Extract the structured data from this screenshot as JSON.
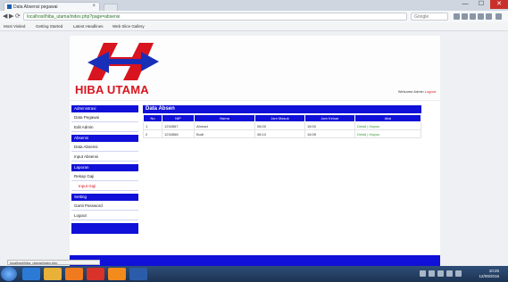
{
  "browser": {
    "tab_title": "Data Absensi pegawai",
    "tab_close": "×",
    "window_buttons": [
      "—",
      "☐",
      "✕"
    ],
    "nav": [
      "◀",
      "▶",
      "⟳"
    ],
    "url": "localhost/hiba_utama/index.php?page=absensi",
    "search_placeholder": "Google",
    "bookmarks": [
      "Most Visited",
      "Getting Started",
      "Latest Headlines",
      "Web Slice Gallery"
    ]
  },
  "site": {
    "logo_text": "HIBA UTAMA",
    "welcome": "Welcome Admin",
    "logout": "Logout"
  },
  "sidebar": {
    "groups": [
      {
        "title": "Administrasi",
        "items": [
          {
            "label": "Data Pegawai",
            "red": false
          },
          {
            "label": "Edit Admin",
            "red": false
          }
        ]
      },
      {
        "title": "Absensi",
        "items": [
          {
            "label": "Data Absensi",
            "red": false
          },
          {
            "label": "Input Absensi",
            "red": false
          }
        ]
      },
      {
        "title": "Laporan",
        "items": [
          {
            "label": "Rekap Gaji",
            "red": false
          },
          {
            "label": "Input Gaji",
            "red": true
          }
        ]
      },
      {
        "title": "Setting",
        "items": [
          {
            "label": "Ganti Password",
            "red": false
          },
          {
            "label": "Logout",
            "red": false
          }
        ]
      }
    ]
  },
  "content": {
    "title": "Data Absen",
    "columns": [
      "No",
      "NIP",
      "Nama",
      "Jam Masuk",
      "Jam Keluar",
      "Aksi"
    ],
    "rows": [
      [
        "1",
        "1234567",
        "Ahmad",
        "08:00",
        "16:00",
        "Detail | Hapus"
      ],
      [
        "2",
        "1234568",
        "Budi",
        "08:10",
        "16:05",
        "Detail | Hapus"
      ]
    ]
  },
  "statusbar": {
    "text": "localhost/hiba_utama/index.php"
  },
  "taskbar": {
    "clock_time": "10:25",
    "clock_date": "12/09/2016",
    "colors": {
      "ie": "#2b7bd6",
      "explorer": "#e8b13a",
      "media": "#f07a1e",
      "chrome": "#d8322b",
      "xampp": "#f38a1c",
      "word": "#2a5caa"
    }
  }
}
